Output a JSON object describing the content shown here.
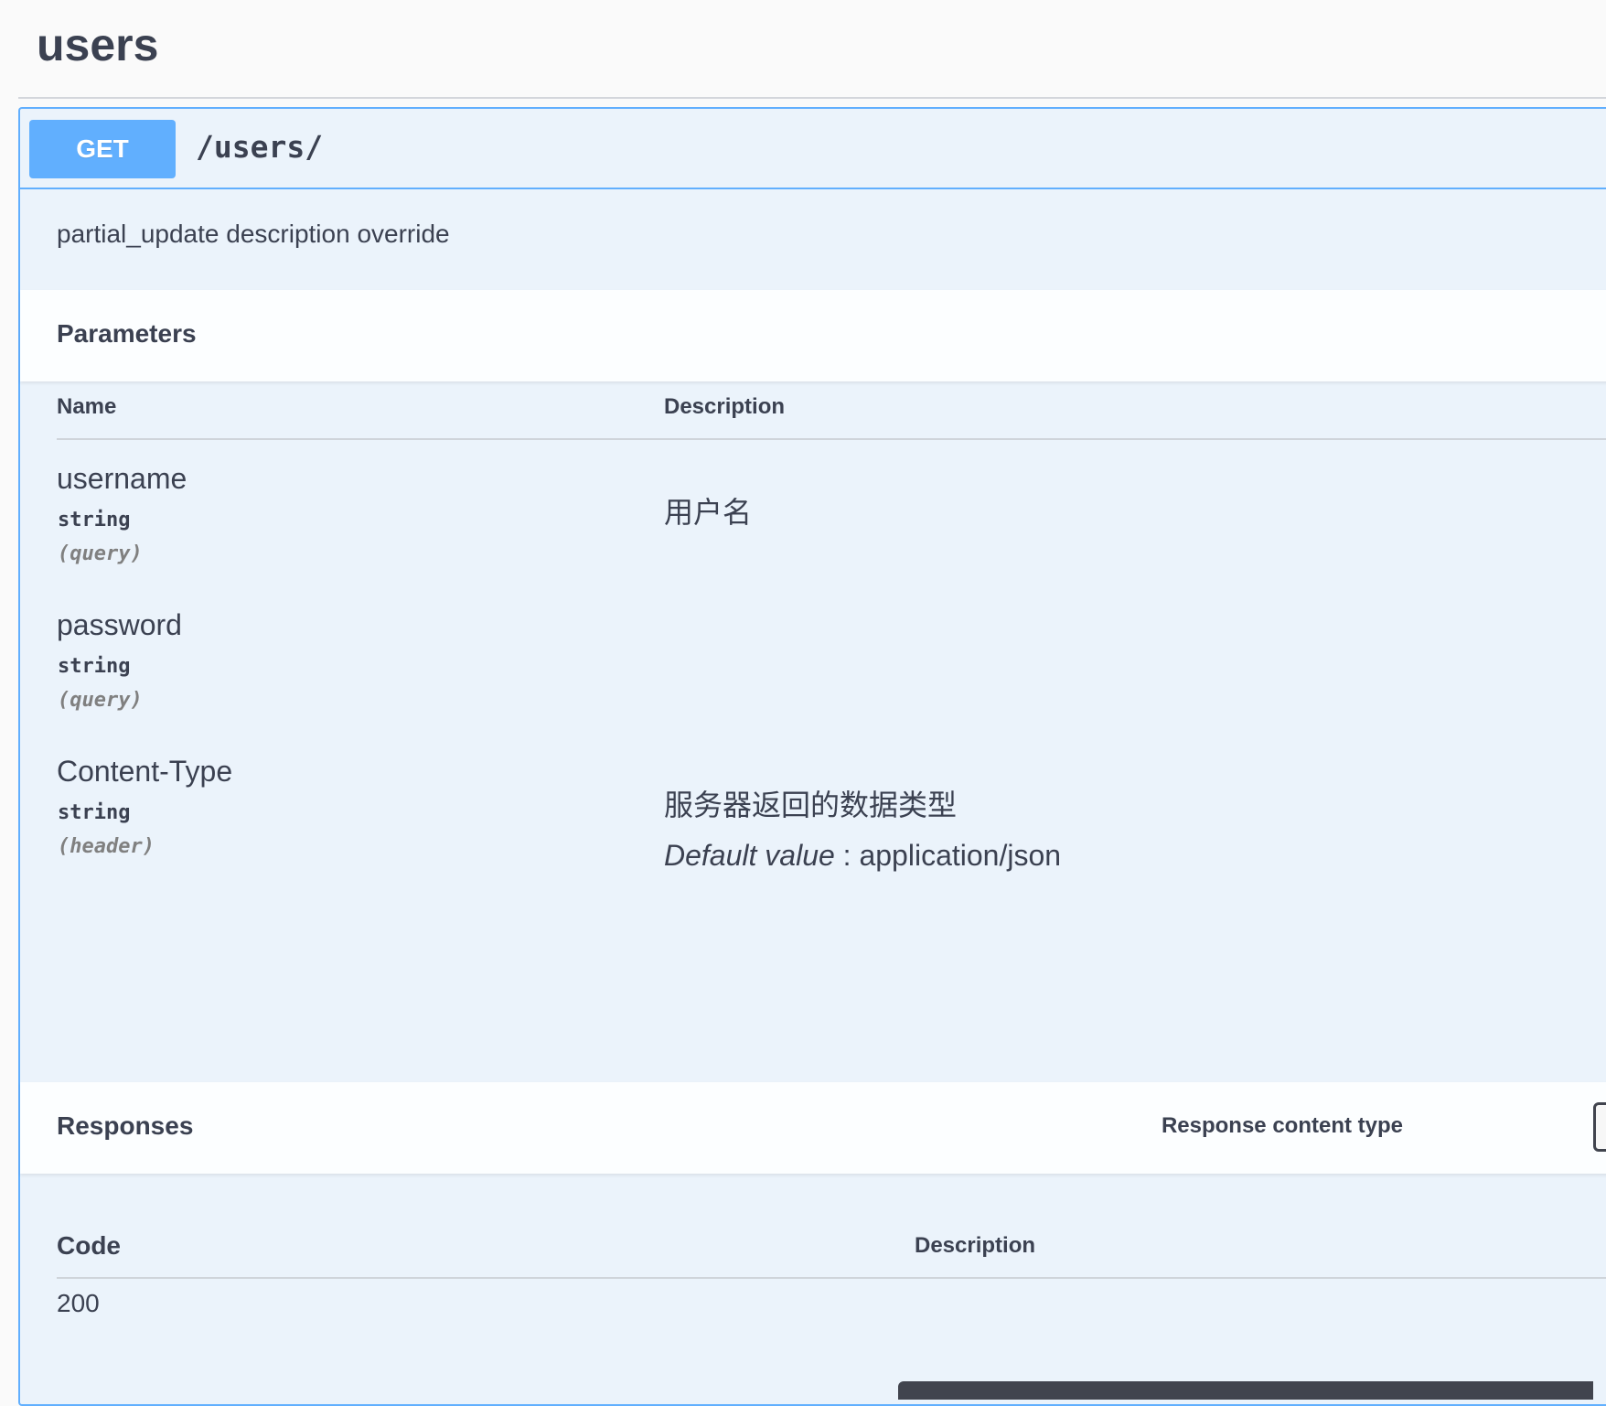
{
  "tag": {
    "title": "users"
  },
  "operation": {
    "method": "GET",
    "path": "/users/",
    "description": "partial_update description override"
  },
  "parameters": {
    "title": "Parameters",
    "columns": {
      "name": "Name",
      "description": "Description"
    },
    "items": [
      {
        "name": "username",
        "type": "string",
        "in": "(query)",
        "description": "用户名"
      },
      {
        "name": "password",
        "type": "string",
        "in": "(query)",
        "description": ""
      },
      {
        "name": "Content-Type",
        "type": "string",
        "in": "(header)",
        "description": "服务器返回的数据类型",
        "default_label": "Default value",
        "default_sep": " : ",
        "default_value": "application/json"
      }
    ]
  },
  "responses": {
    "title": "Responses",
    "content_type_label": "Response content type",
    "columns": {
      "code": "Code",
      "description": "Description"
    },
    "items": [
      {
        "code": "200"
      }
    ]
  },
  "colors": {
    "get_accent": "#61affe",
    "block_bg": "#ebf3fb",
    "text": "#3b4151"
  }
}
